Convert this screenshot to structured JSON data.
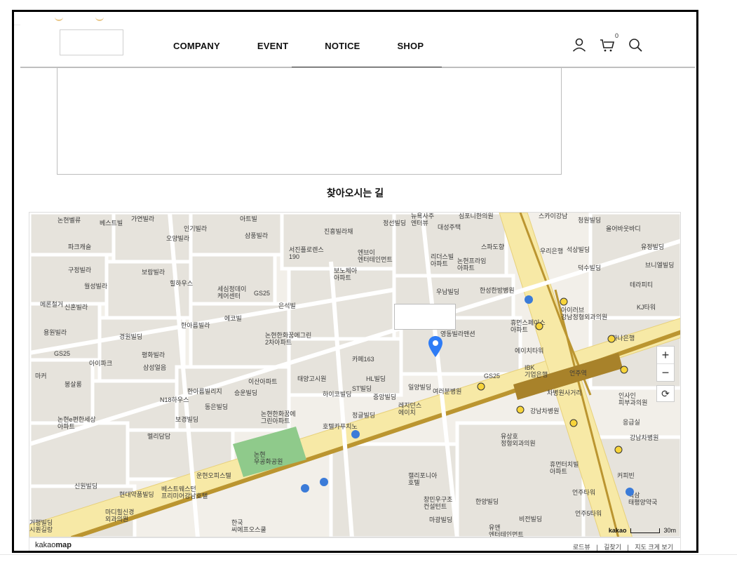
{
  "header": {
    "nav": [
      "COMPANY",
      "EVENT",
      "NOTICE",
      "SHOP"
    ],
    "cart_count": "0",
    "icons": [
      "user-icon",
      "cart-icon",
      "search-icon"
    ]
  },
  "section": {
    "title": "찾아오시는 길"
  },
  "map": {
    "brand_prefix": "kakao",
    "brand_suffix": "map",
    "footer_links": [
      "로드뷰",
      "길찾기",
      "지도 크게 보기"
    ],
    "scale_brand": "kakao",
    "scale_label": "30m",
    "zoom_in": "+",
    "zoom_out": "−",
    "reset": "⟳",
    "labels": {
      "nonhyeon_park": "논현\n우공화공원",
      "yangdong_villa": "영동빌라맨션",
      "gangnam_cha": "강남차병원",
      "eonju_station": "언주역",
      "hotel_california": "캘리포니아\n호텔",
      "ibk": "IBK\n기업은행",
      "gs25": "GS25",
      "cafe163": "카페163",
      "hl_building": "HL빌딩",
      "st_building": "ST빌딩",
      "hyumans": "휴먼스페이스\n아파트",
      "eoji_tower": "에이치타워",
      "jinheung": "진흥빌라채",
      "seojin": "서진플로렌스\n190",
      "enboi": "엔브이\n엔터테인먼트",
      "woonam": "우남빌딩",
      "hanseong": "한성한방병원",
      "unhyeon": "운현오피스텔",
      "best_western": "베스트웨스턴\n프리미어강남호텔",
      "charter": "차병원사거리",
      "hanhwa": "논현한화꿈에그린\n2차아파트",
      "taeyang": "태양고시원",
      "hanareum": "한아름빌라",
      "ilgwang": "일양빌딩",
      "yeouibun": "여러분병원",
      "sama_lab": "삼성얼음",
      "yuan": "유앤\n엔터테인먼트",
      "chanmin": "창민우구조\n컨설턴트",
      "hanyang": "한양빌딩",
      "magwang": "마광빌딩",
      "bijeon": "비전빌딩",
      "eonju_tower": "언주타워",
      "eonju5": "언주5타워",
      "coffee": "커피빈",
      "teapyeong": "역삼\n태평양약국",
      "ugeum": "응급실",
      "gangnam_hosp": "강남차병원",
      "inssain": "인사인\n피부과의원",
      "hanaro": "하나은행",
      "kj_tower": "KJ타워",
      "therapy": "테라피티",
      "youjeong": "유정빌딩",
      "bni": "브니엘빌딩",
      "deoksu": "덕수빌딩",
      "seoksan": "석상빌딩",
      "woori": "우리은행",
      "olbabupeu": "올어바웃바디",
      "cheongwon": "청원빌딩",
      "spodo": "스파도향",
      "riduseu": "리더스빌\n아파트",
      "nonhyeon_prime": "논현프라임\n아파트",
      "bono": "보노체아\n아파트",
      "sesim": "세심정데이\n케어센터",
      "eunseok": "은석빌",
      "ecobil": "에코빌",
      "gs25b": "GS25",
      "hilhaus": "힐하우스",
      "wolsung": "월성빌라",
      "bolam": "보람빌라",
      "gujeong": "구정빌라",
      "parkcastle": "파크캐슬",
      "ohyang": "오양빌라",
      "ingi": "인기빌라",
      "samheung": "삼풍빌라",
      "ateubil": "아트빌",
      "gayeon": "가연빌라",
      "bestbil": "베스트빌",
      "nonhyeon_bel": "논현벨류",
      "meron": "메론철거",
      "sinhon": "신혼빌라",
      "yongwon": "용원빌라",
      "gyeongwon": "경원빌딩",
      "pyeonghwa": "평화빌라",
      "aipak": "아이파크",
      "maker": "마커",
      "bongsalong": "봉살롱",
      "n18": "N18하우스",
      "hanareum2": "한아름빌리지",
      "seungun": "승운빌딩",
      "isan": "이산아파트",
      "hiko": "하이코빌딩",
      "jungang": "중앙빌딩",
      "residence": "레지던스\n에이치",
      "jeonggeul": "정글빌딩",
      "hotel_kafu": "호텔카푸치노",
      "hanwha2": "논현한화꿈에\n그린아파트",
      "boyeong": "보경빌딩",
      "dongeun": "동은빌딩",
      "mellidim": "멜리담담",
      "nonhyeon_e": "논현e편한세상\n아파트",
      "madi": "마디힐신경\n외과의원",
      "hyundai": "현대약품빌딩",
      "sinwon": "신원빌딩",
      "geopyeong": "거평빌딩\n시퀀길랑",
      "hanguk": "한국\n씨에프오스쿨",
      "yusangho": "유상호\n정형외과의원",
      "humeon": "휴먼터치빌\n아파트",
      "irlove": "아이러브\n강남정형외과의원",
      "samsung_joeun": "심포니한의원",
      "daeseong": "대성주택",
      "jeongseon": "정선빌딩",
      "nyuyu": "뉴욕사주\n엔터뷰",
      "skygangnam": "스카이강남"
    }
  }
}
